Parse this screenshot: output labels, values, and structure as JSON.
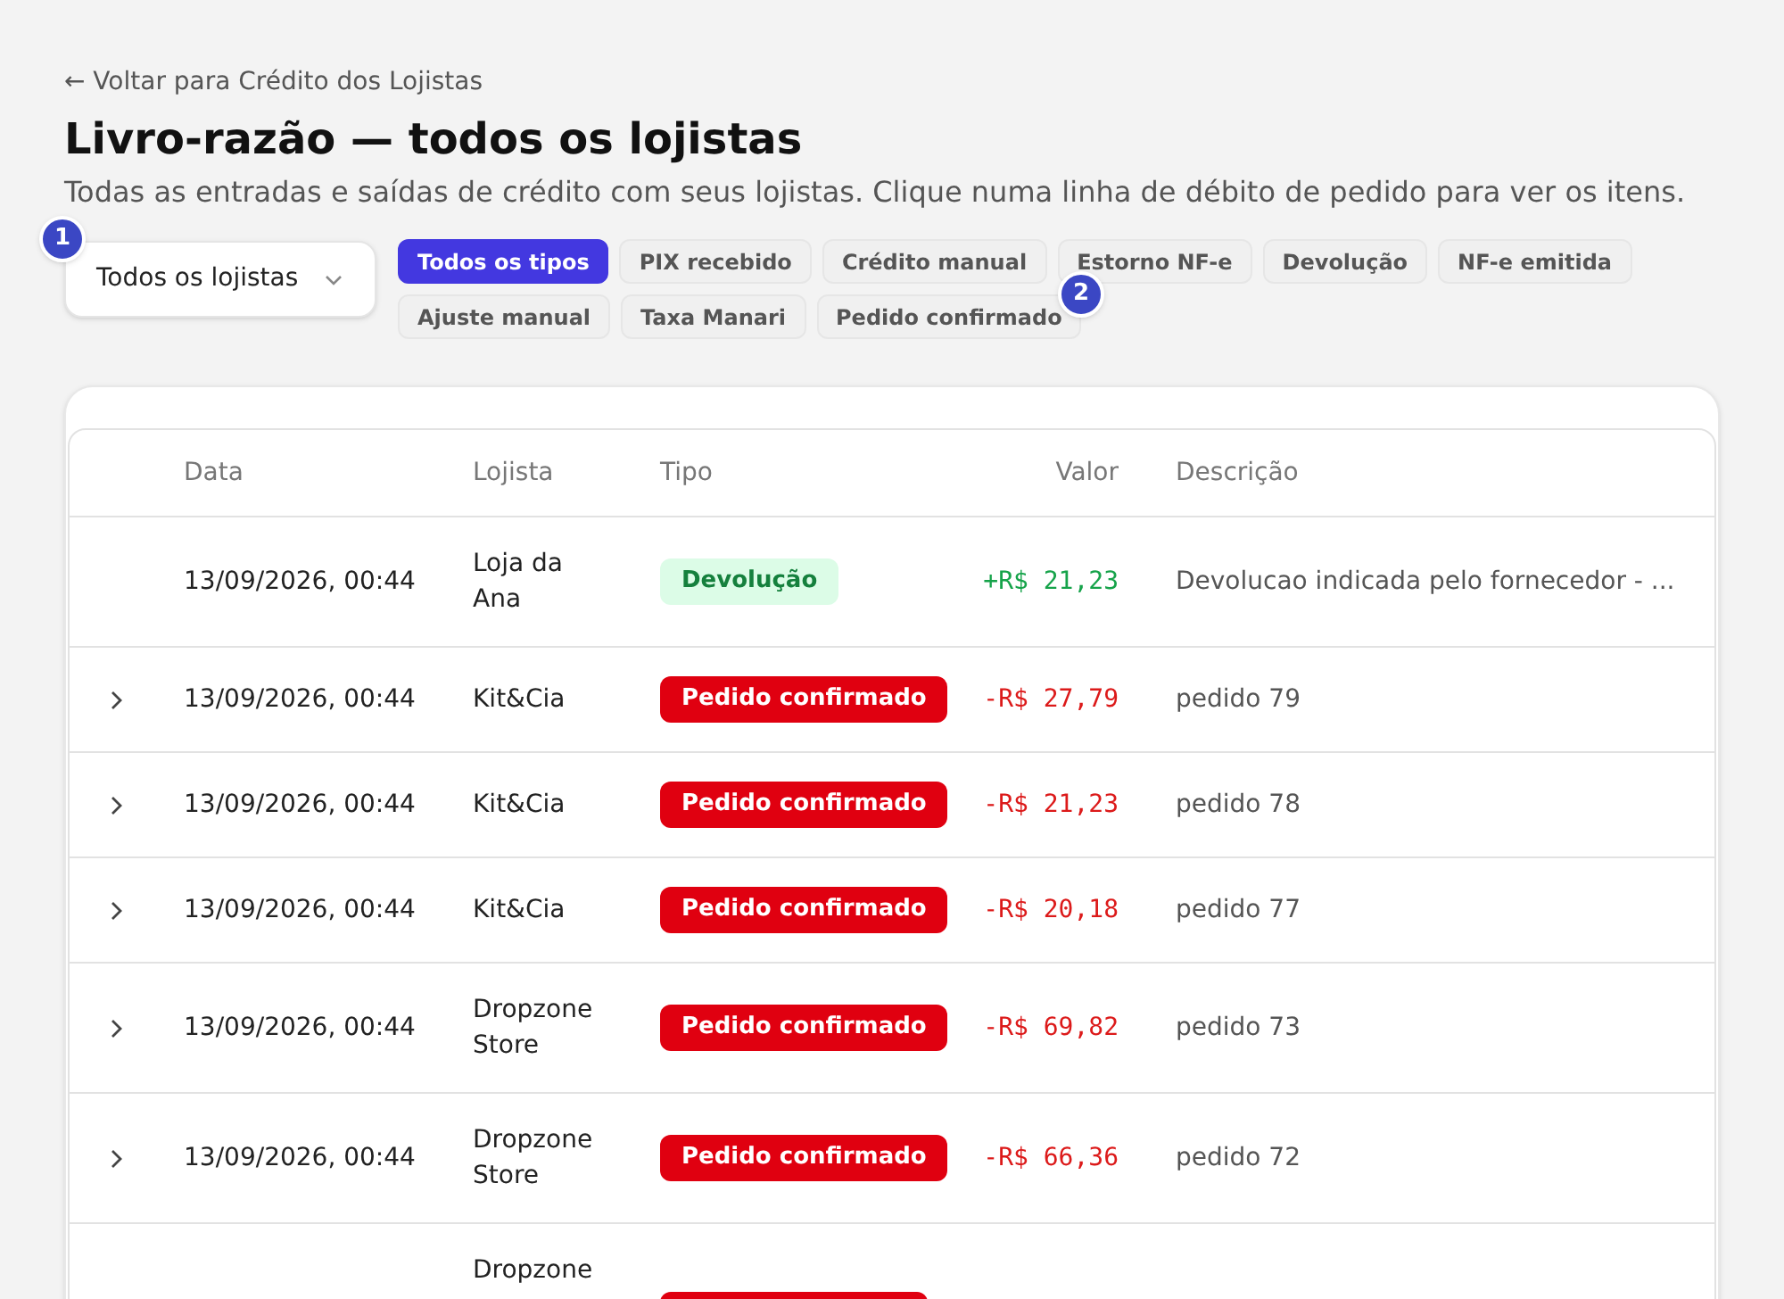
{
  "back_link": "← Voltar para Crédito dos Lojistas",
  "title": "Livro-razão — todos os lojistas",
  "subtitle": "Todas as entradas e saídas de crédito com seus lojistas. Clique numa linha de débito de pedido para ver os itens.",
  "store_select": {
    "value": "Todos os lojistas"
  },
  "markers": [
    "1",
    "2"
  ],
  "type_filters": [
    {
      "label": "Todos os tipos",
      "selected": true
    },
    {
      "label": "PIX recebido",
      "selected": false
    },
    {
      "label": "Crédito manual",
      "selected": false
    },
    {
      "label": "Estorno NF-e",
      "selected": false
    },
    {
      "label": "Devolução",
      "selected": false
    },
    {
      "label": "NF-e emitida",
      "selected": false
    },
    {
      "label": "Ajuste manual",
      "selected": false
    },
    {
      "label": "Taxa Manari",
      "selected": false
    },
    {
      "label": "Pedido confirmado",
      "selected": false
    }
  ],
  "table": {
    "columns": [
      "Data",
      "Lojista",
      "Tipo",
      "Valor",
      "Descrição"
    ],
    "rows": [
      {
        "kind": "credit",
        "expandable": false,
        "date": "13/09/2026, 00:44",
        "store": "Loja da Ana",
        "type": "Devolução",
        "value": "+R$ 21,23",
        "description": "Devolucao indicada pelo fornecedor - ..."
      },
      {
        "kind": "debit",
        "expandable": true,
        "date": "13/09/2026, 00:44",
        "store": "Kit&Cia",
        "type": "Pedido confirmado",
        "value": "-R$ 27,79",
        "description": "pedido 79"
      },
      {
        "kind": "debit",
        "expandable": true,
        "date": "13/09/2026, 00:44",
        "store": "Kit&Cia",
        "type": "Pedido confirmado",
        "value": "-R$ 21,23",
        "description": "pedido 78"
      },
      {
        "kind": "debit",
        "expandable": true,
        "date": "13/09/2026, 00:44",
        "store": "Kit&Cia",
        "type": "Pedido confirmado",
        "value": "-R$ 20,18",
        "description": "pedido 77"
      },
      {
        "kind": "debit",
        "expandable": true,
        "date": "13/09/2026, 00:44",
        "store": "Dropzone Store",
        "type": "Pedido confirmado",
        "value": "-R$ 69,82",
        "description": "pedido 73"
      },
      {
        "kind": "debit",
        "expandable": true,
        "date": "13/09/2026, 00:44",
        "store": "Dropzone Store",
        "type": "Pedido confirmado",
        "value": "-R$ 66,36",
        "description": "pedido 72"
      },
      {
        "kind": "debit",
        "store": "Dropzone"
      }
    ]
  }
}
